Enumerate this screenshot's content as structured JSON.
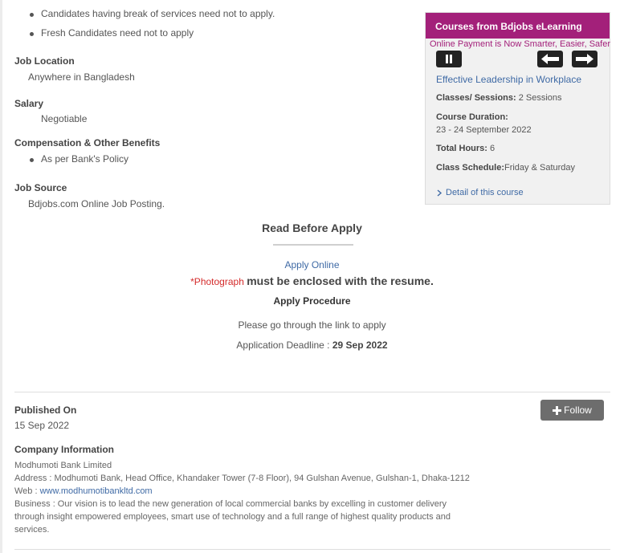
{
  "requirements": {
    "bullets": [
      "Candidates having break of services need not to apply.",
      "Fresh Candidates need not to apply"
    ]
  },
  "job_location": {
    "label": "Job Location",
    "value": "Anywhere in Bangladesh"
  },
  "salary": {
    "label": "Salary",
    "value": "Negotiable"
  },
  "benefits": {
    "label": "Compensation & Other Benefits",
    "bullets": [
      "As per Bank's Policy"
    ]
  },
  "job_source": {
    "label": "Job Source",
    "value": "Bdjobs.com Online Job Posting."
  },
  "sidebar": {
    "title": "Courses from Bdjobs eLearning",
    "tagline": "Online Payment is Now Smarter, Easier, Safer",
    "course_title": "Effective Leadership in Workplace",
    "classes_label": "Classes/ Sessions:",
    "classes_value": "2 Sessions",
    "duration_label": "Course Duration:",
    "duration_value": "23 - 24 September 2022",
    "hours_label": "Total Hours:",
    "hours_value": "6",
    "schedule_label": "Class Schedule:",
    "schedule_value": "Friday & Saturday",
    "detail_link": "Detail of this course"
  },
  "apply": {
    "heading": "Read Before Apply",
    "apply_online": "Apply Online",
    "photo_word": "*Photograph",
    "photo_rest": "must be enclosed with the resume.",
    "procedure": "Apply Procedure",
    "instruction": "Please go through the link to apply",
    "deadline_label": "Application Deadline :",
    "deadline_value": "29 Sep 2022"
  },
  "published": {
    "label": "Published On",
    "value": "15 Sep 2022",
    "follow_label": "Follow"
  },
  "company": {
    "heading": "Company Information",
    "name": "Modhumoti Bank Limited",
    "address": "Address : Modhumoti Bank, Head Office, Khandaker Tower (7-8 Floor), 94 Gulshan Avenue, Gulshan-1, Dhaka-1212",
    "web_label": "Web :",
    "web_url": "www.modhumotibankltd.com",
    "business_line1": "Business : Our vision is to lead the new generation of local commercial banks by excelling in customer delivery",
    "business_line2": "through insight empowered employees, smart use of technology and a full range of highest quality products and",
    "business_line3": "services."
  },
  "colors": {
    "accent": "#a3207a",
    "link": "#3f6aa5",
    "required": "#d42a2a",
    "follow_bg": "#6d6d6d"
  }
}
